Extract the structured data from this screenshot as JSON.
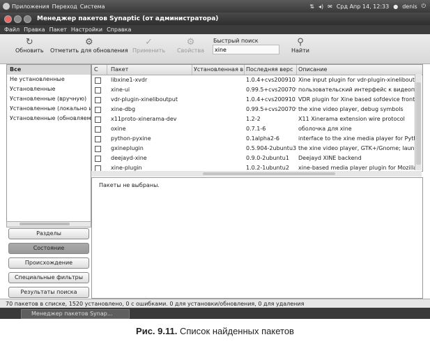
{
  "panel": {
    "apps": "Приложения",
    "places": "Переход",
    "system": "Система",
    "datetime": "Срд Апр 14, 12:33",
    "user": "denis"
  },
  "window": {
    "title": "Менеджер пакетов Synaptic  (от администратора)"
  },
  "menu": [
    "Файл",
    "Правка",
    "Пакет",
    "Настройки",
    "Справка"
  ],
  "toolbar": {
    "reload": "Обновить",
    "mark_upgrades": "Отметить для обновления",
    "apply": "Применить",
    "properties": "Свойства",
    "search_label": "Быстрый поиск",
    "search_value": "xine",
    "find": "Найти"
  },
  "filters": [
    "Все",
    "Не установленные",
    "Установленные",
    "Установленные (вручную)",
    "Установленные (локально и",
    "Установленные (обновляем"
  ],
  "filter_buttons": [
    "Разделы",
    "Состояние",
    "Происхождение",
    "Специальные фильтры",
    "Результаты поиска"
  ],
  "columns": {
    "status": "С",
    "package": "Пакет",
    "installed": "Установленная в",
    "latest": "Последняя верс",
    "description": "Описание"
  },
  "packages": [
    {
      "name": "libxine1-xvdr",
      "installed": "",
      "latest": "1.0.4+cvs2009101",
      "desc": "Xine input plugin for vdr-plugin-xineliboutput"
    },
    {
      "name": "xine-ui",
      "installed": "",
      "latest": "0.99.5+cvs200709",
      "desc": "пользовательский интерфейс к видеопр"
    },
    {
      "name": "vdr-plugin-xineliboutput",
      "installed": "",
      "latest": "1.0.4+cvs2009101",
      "desc": "VDR plugin for Xine based sofdevice frontend"
    },
    {
      "name": "xine-dbg",
      "installed": "",
      "latest": "0.99.5+cvs200709",
      "desc": "the xine video player, debug symbols"
    },
    {
      "name": "x11proto-xinerama-dev",
      "installed": "",
      "latest": "1.2-2",
      "desc": "X11 Xinerama extension wire protocol"
    },
    {
      "name": "oxine",
      "installed": "",
      "latest": "0.7.1-6",
      "desc": "оболочка для xine"
    },
    {
      "name": "python-pyxine",
      "installed": "",
      "latest": "0.1alpha2-6",
      "desc": "interface to the xine media player for Python"
    },
    {
      "name": "gxineplugin",
      "installed": "",
      "latest": "0.5.904-2ubuntu3",
      "desc": "the xine video player, GTK+/Gnome; launch"
    },
    {
      "name": "deejayd-xine",
      "installed": "",
      "latest": "0.9.0-2ubuntu1",
      "desc": "Deejayd XINE backend"
    },
    {
      "name": "xine-plugin",
      "installed": "",
      "latest": "1.0.2-1ubuntu2",
      "desc": "xine-based media player plugin for Mozilla"
    }
  ],
  "details": "Пакеты не выбраны.",
  "status": "70 пакетов в списке, 1520 установлено, 0 с ошибками. 0 для установки/обновления, 0 для удаления",
  "taskbar": {
    "task": "Менеджер пакетов Synap..."
  },
  "caption": {
    "label": "Рис. 9.11.",
    "text": " Список найденных пакетов"
  }
}
